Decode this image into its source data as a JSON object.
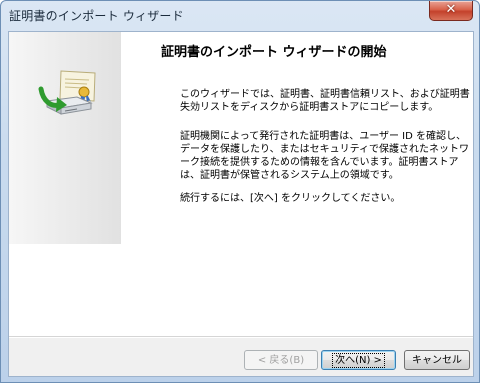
{
  "window": {
    "title": "証明書のインポート ウィザード",
    "close_label": "✕"
  },
  "wizard": {
    "heading": "証明書のインポート ウィザードの開始",
    "paragraphs": [
      "このウィザードでは、証明書、証明書信頼リスト、および証明書失効リストをディスクから証明書ストアにコピーします。",
      "証明機関によって発行された証明書は、ユーザー ID を確認し、データを保護したり、またはセキュリティで保護されたネットワーク接続を提供するための情報を含んでいます。証明書ストアは、証明書が保管されるシステム上の領域です。",
      "続行するには、[次へ] をクリックしてください。"
    ],
    "art_icon": "certificate-import-icon"
  },
  "buttons": {
    "back": "< 戻る(B)",
    "next": "次へ(N) >",
    "cancel": "キャンセル"
  }
}
